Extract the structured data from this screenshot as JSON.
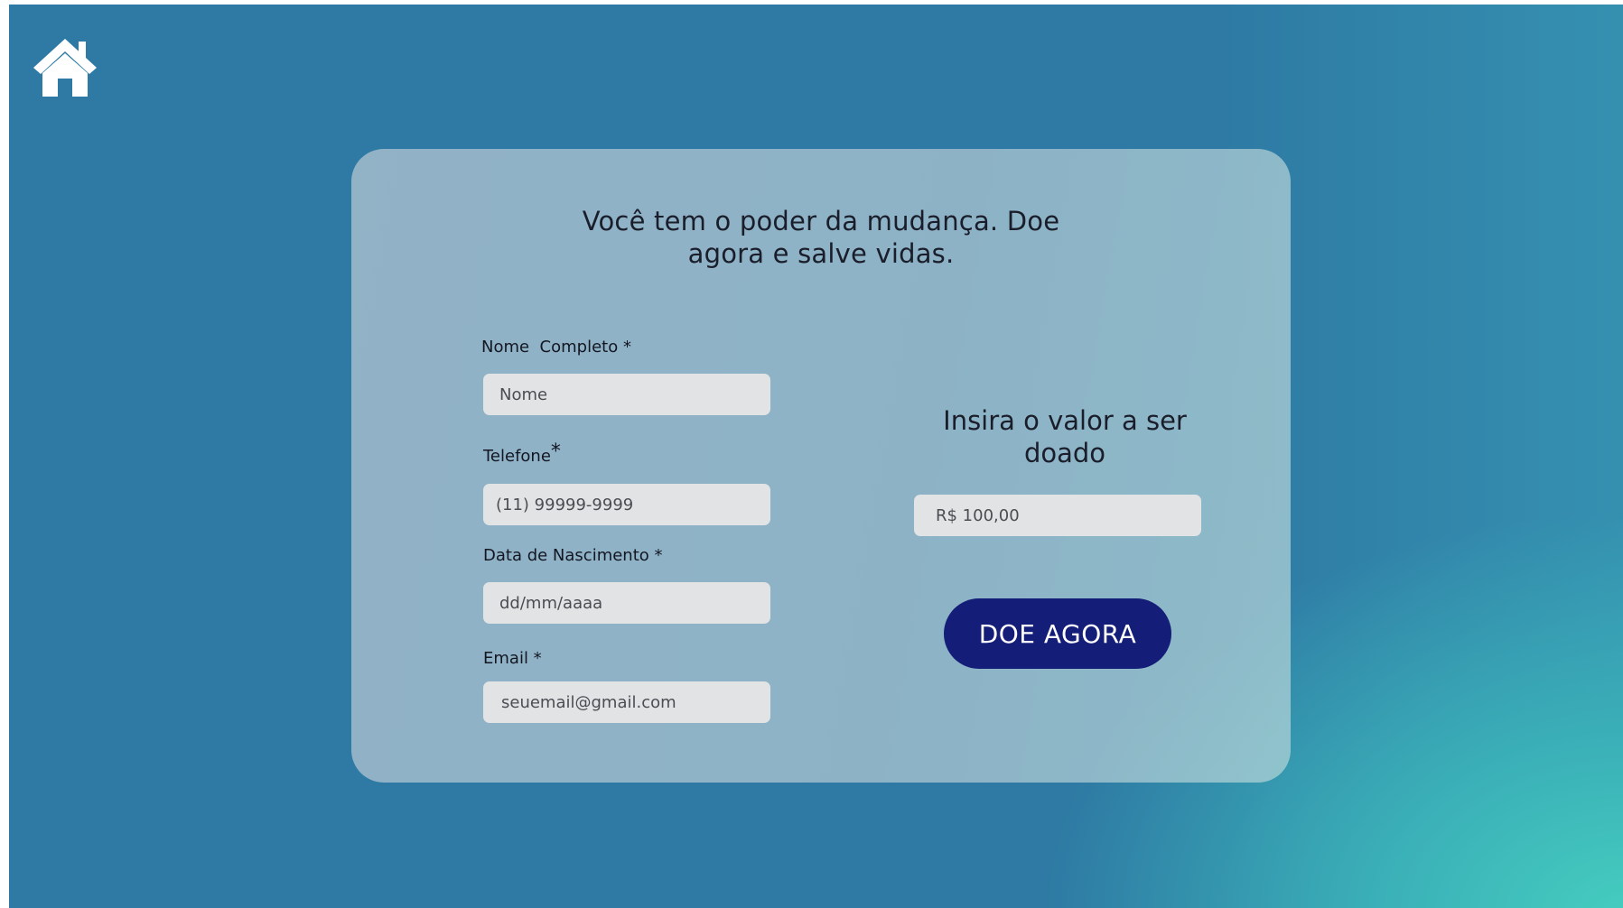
{
  "nav": {
    "home_icon": "home-icon"
  },
  "colors": {
    "background": "#2e7aa4",
    "background_accent": "#45cdbf",
    "button": "#141d78",
    "field": "#e2e3e4"
  },
  "card": {
    "headline": "Você tem o poder da mudança. Doe agora e salve vidas.",
    "form": {
      "name": {
        "label": "Nome  Completo *",
        "placeholder": "Nome"
      },
      "phone": {
        "label": "Telefone",
        "required_mark": "*",
        "placeholder": "(11) 99999-9999"
      },
      "birthdate": {
        "label": "Data de Nascimento *",
        "placeholder": "dd/mm/aaaa"
      },
      "email": {
        "label": "Email *",
        "placeholder": "seuemail@gmail.com"
      }
    },
    "donation": {
      "title": "Insira o valor a ser doado",
      "amount_placeholder": "R$ 100,00",
      "button_label": "DOE AGORA"
    }
  }
}
